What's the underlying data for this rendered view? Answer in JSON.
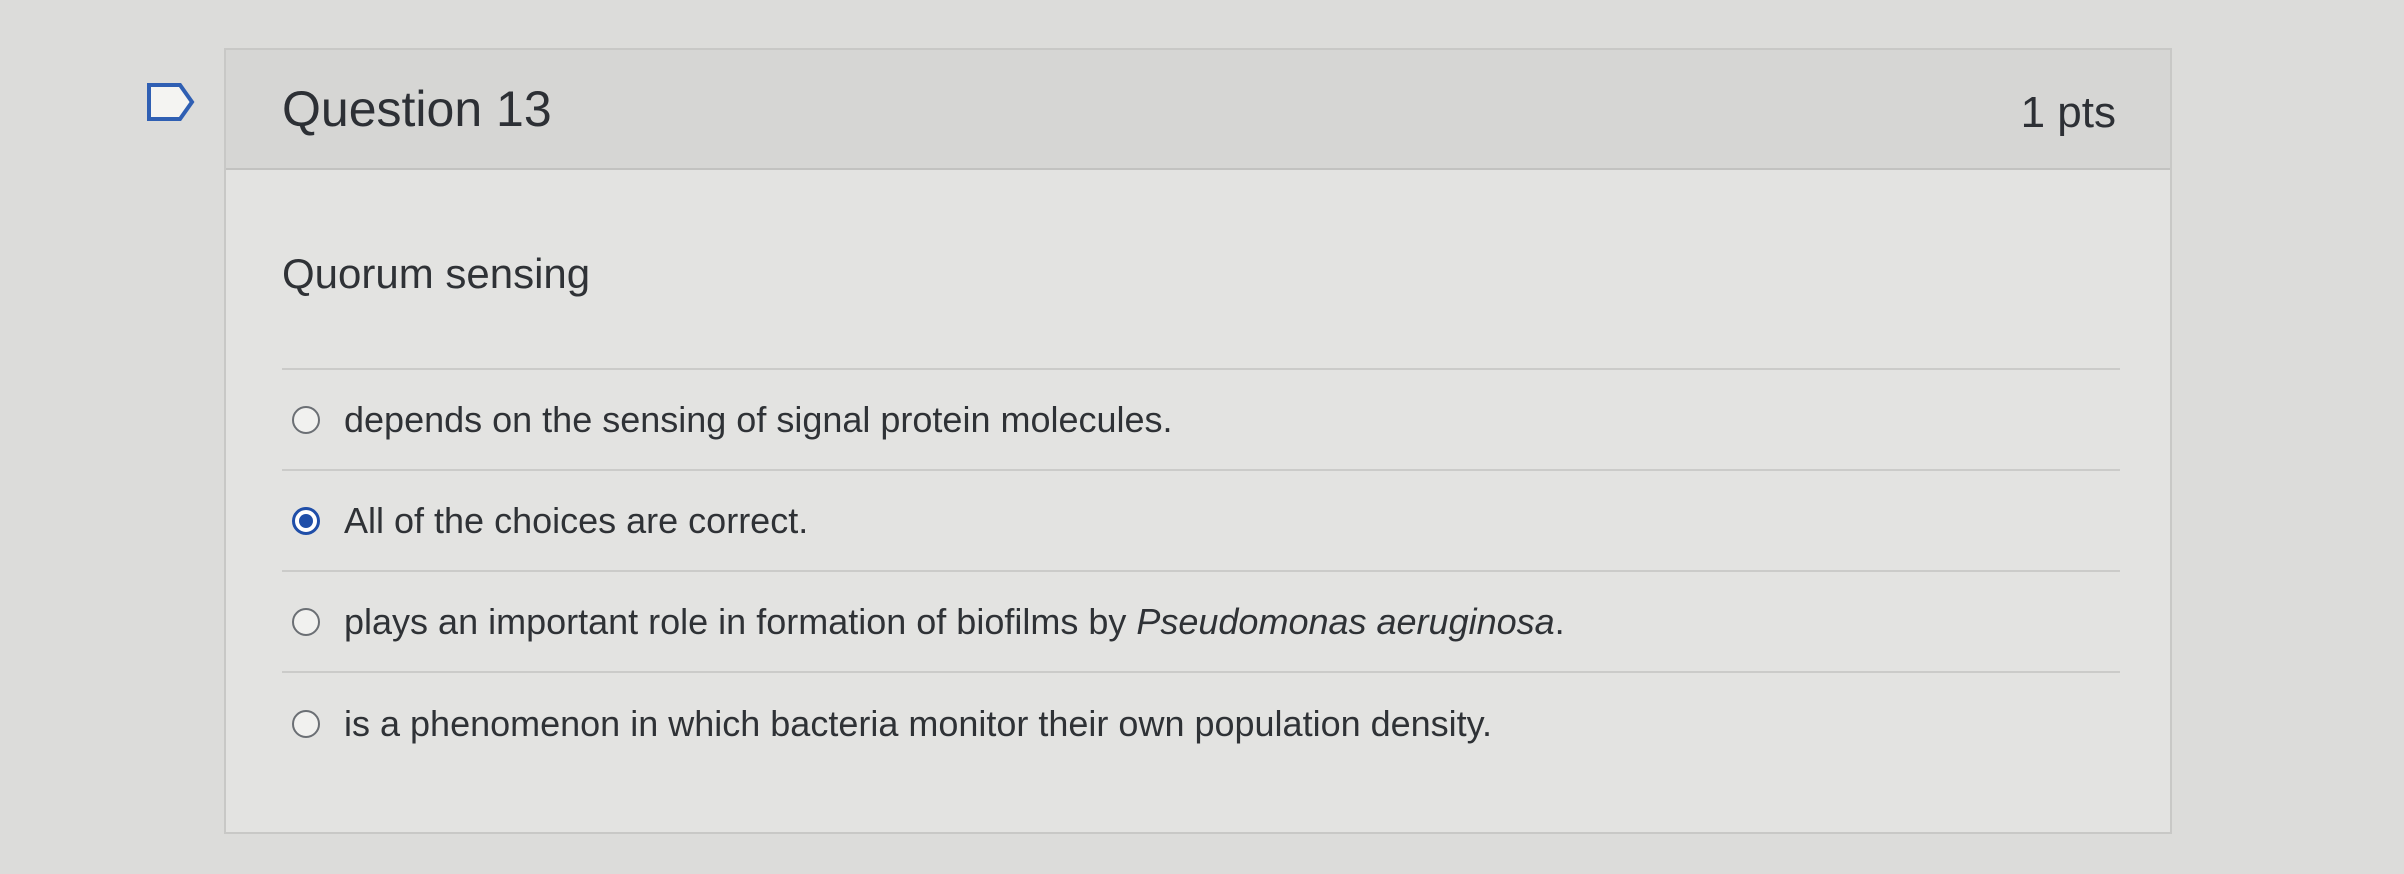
{
  "question": {
    "title": "Question 13",
    "points": "1 pts",
    "prompt": "Quorum sensing",
    "answers": [
      {
        "text": "depends on the sensing of signal protein molecules.",
        "selected": false
      },
      {
        "text": "All of the choices are correct.",
        "selected": true
      },
      {
        "text_before": "plays an important role in formation of biofilms by ",
        "text_italic": "Pseudomonas aeruginosa",
        "text_after": ".",
        "selected": false
      },
      {
        "text": "is a phenomenon in which bacteria monitor their own population density.",
        "selected": false
      }
    ]
  },
  "icons": {
    "flag": "flag-question-icon"
  },
  "colors": {
    "selected_radio": "#1f4ea8",
    "header_bg": "#d6d6d4",
    "text": "#2f3236"
  }
}
